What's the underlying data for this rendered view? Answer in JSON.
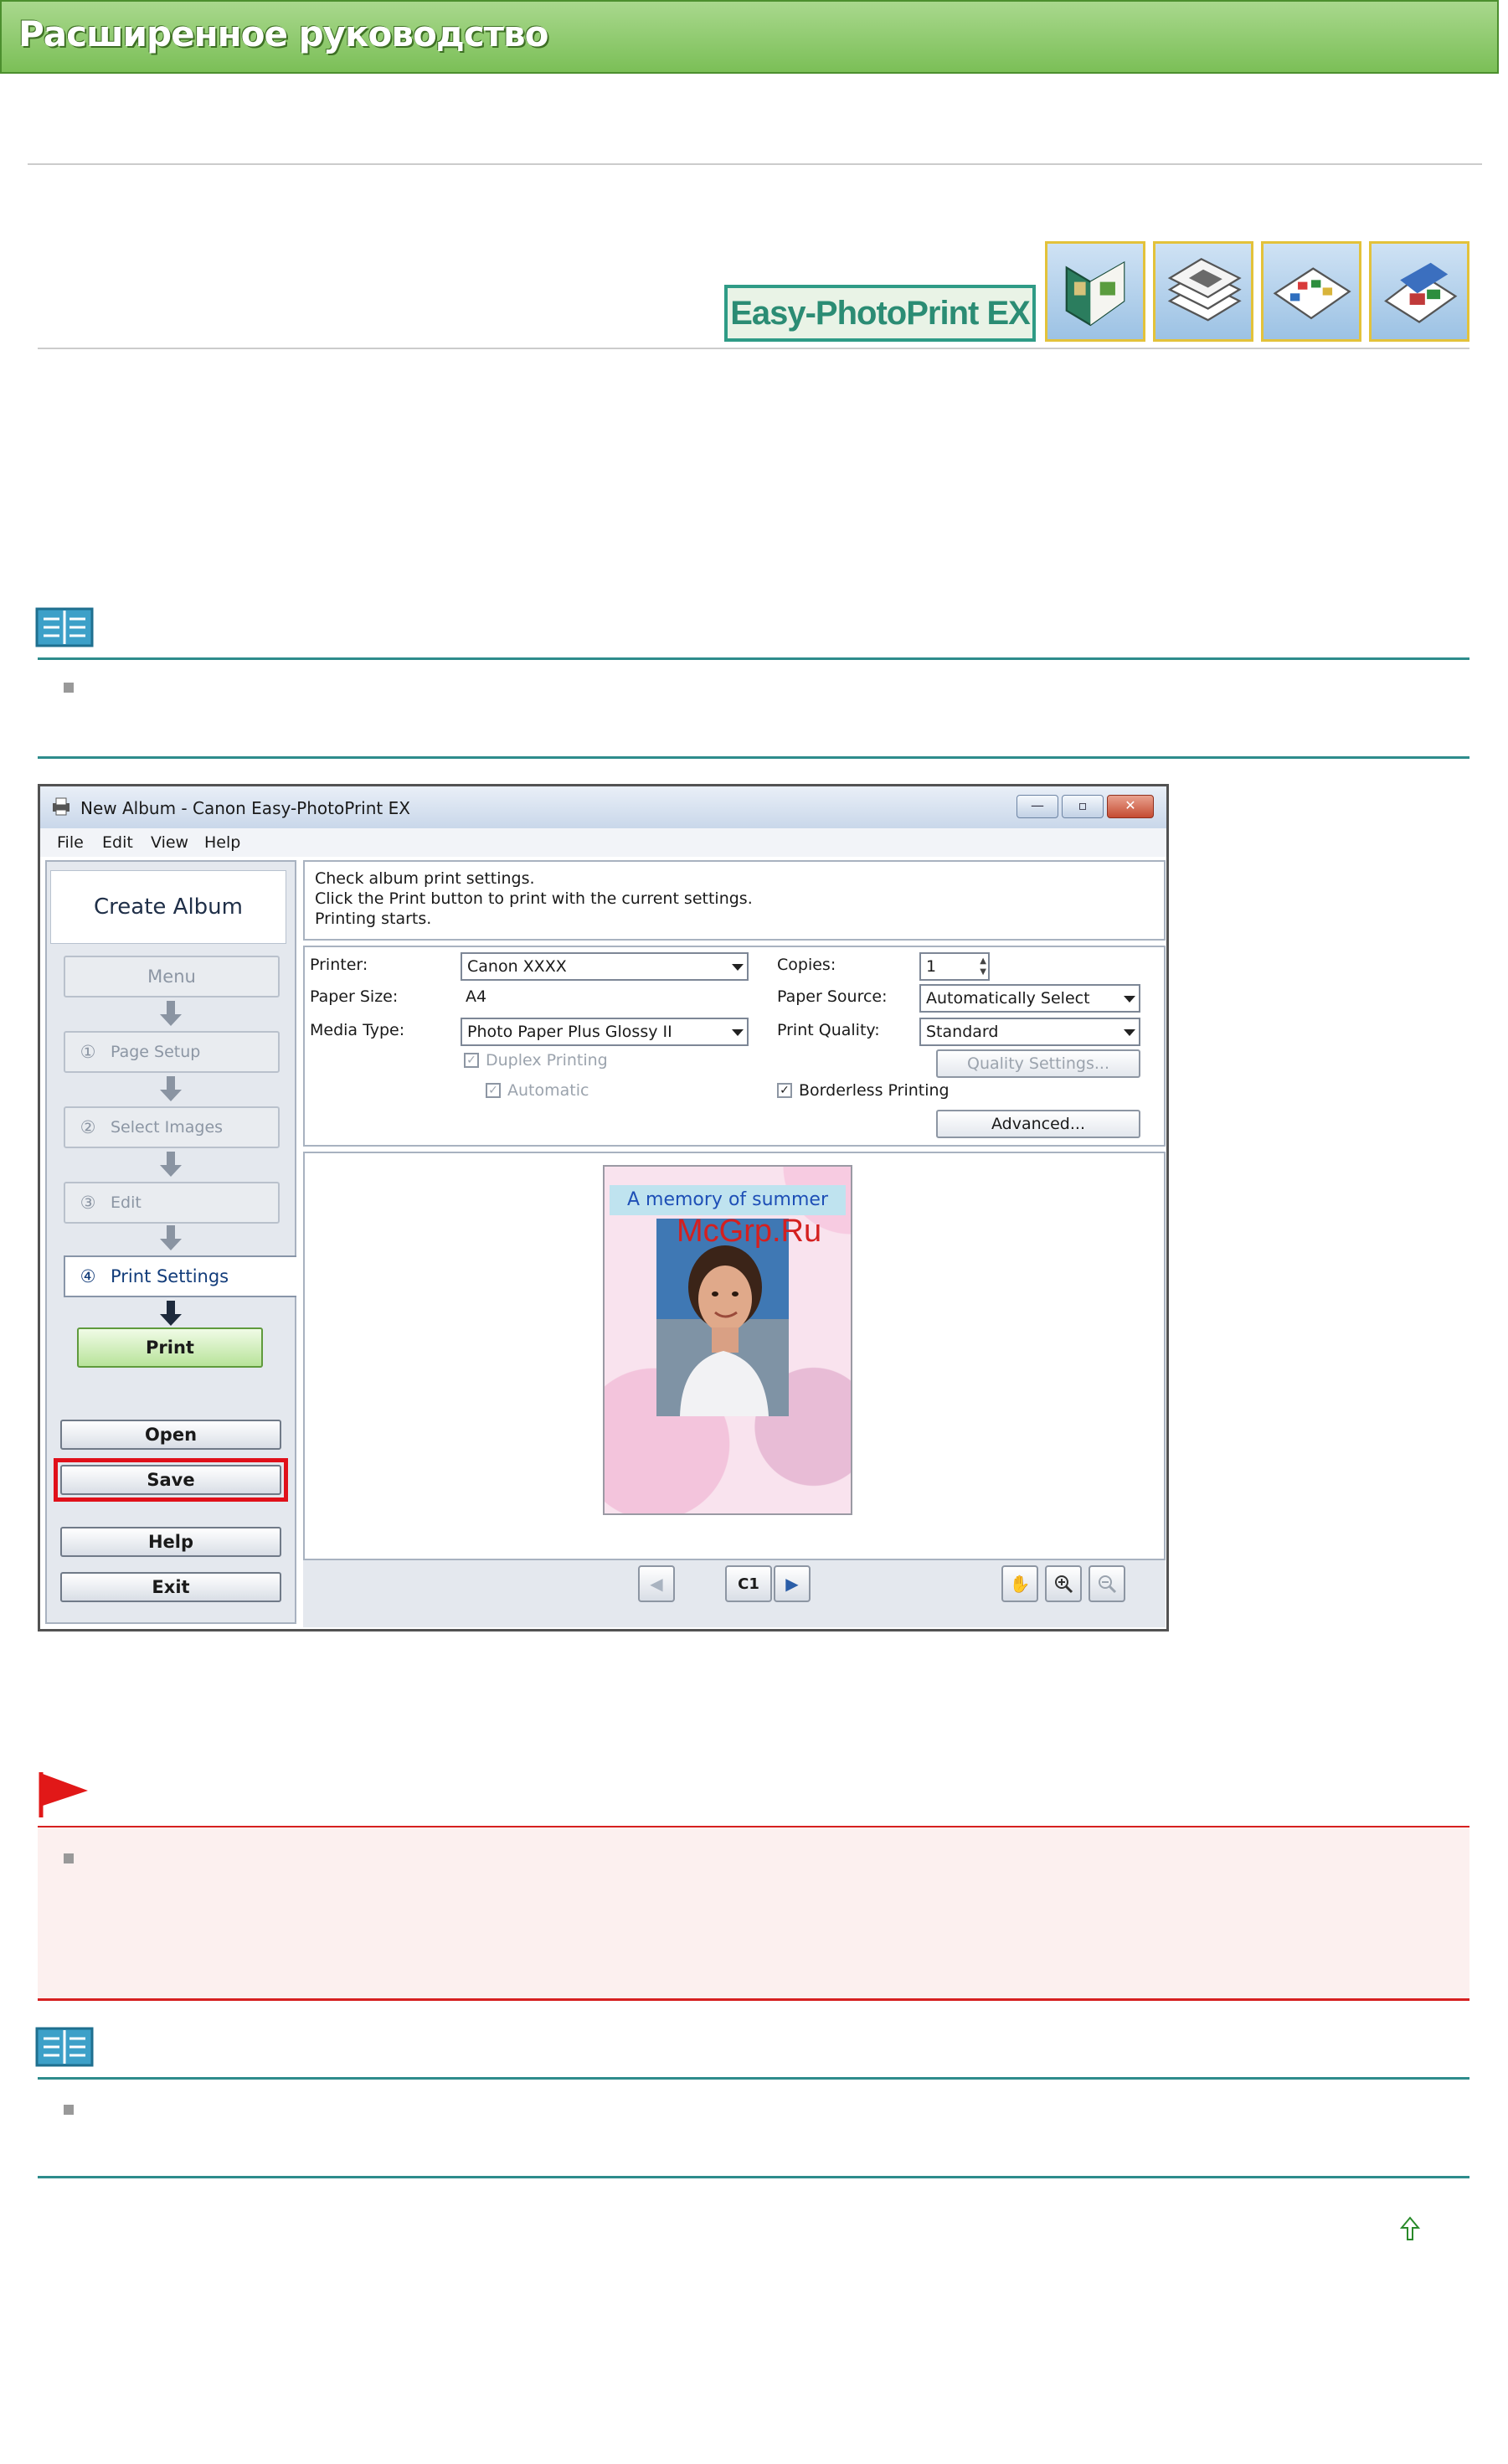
{
  "header": {
    "title": "Расширенное руководство"
  },
  "product": {
    "logo_text": "Easy-PhotoPrint EX",
    "thumbnails": [
      "album-icon",
      "stacked-photos-icon",
      "calendar-icon",
      "layout-print-icon"
    ]
  },
  "app_window": {
    "title": "New Album - Canon Easy-PhotoPrint EX",
    "menu": [
      "File",
      "Edit",
      "View",
      "Help"
    ],
    "sidebar": {
      "heading": "Create Album",
      "steps": [
        {
          "num": "",
          "label": "Menu"
        },
        {
          "num": "①",
          "label": "Page Setup"
        },
        {
          "num": "②",
          "label": "Select Images"
        },
        {
          "num": "③",
          "label": "Edit"
        }
      ],
      "active_step": {
        "num": "④",
        "label": "Print Settings"
      },
      "print_button": "Print",
      "open_button": "Open",
      "save_button": "Save",
      "help_button": "Help",
      "exit_button": "Exit"
    },
    "message_lines": [
      "Check album print settings.",
      "Click the Print button to print with the current settings.",
      "Printing starts."
    ],
    "settings": {
      "printer_label": "Printer:",
      "printer_value": "Canon XXXX",
      "paper_size_label": "Paper Size:",
      "paper_size_value": "A4",
      "media_type_label": "Media Type:",
      "media_type_value": "Photo Paper Plus Glossy II",
      "duplex_label": "Duplex Printing",
      "automatic_label": "Automatic",
      "copies_label": "Copies:",
      "copies_value": "1",
      "paper_source_label": "Paper Source:",
      "paper_source_value": "Automatically Select",
      "print_quality_label": "Print Quality:",
      "print_quality_value": "Standard",
      "quality_settings_button": "Quality Settings...",
      "borderless_label": "Borderless Printing",
      "advanced_button": "Advanced..."
    },
    "preview": {
      "page_title": "A memory of summer",
      "page_indicator": "C1"
    },
    "watermark": "McGrp.Ru"
  },
  "colors": {
    "banner": "#7bbf57",
    "teal_rule": "#2e8c8c",
    "caution_rule": "#d62020",
    "save_highlight": "#e0101a"
  }
}
